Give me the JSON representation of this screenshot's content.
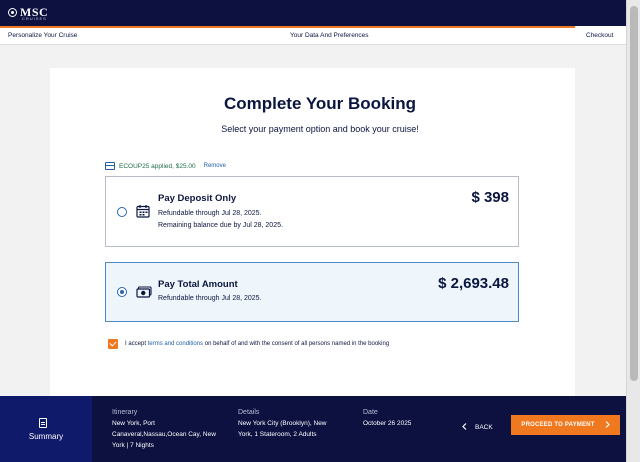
{
  "brand": {
    "name": "MSC",
    "subtitle": "CRUISES"
  },
  "steps": [
    "Personalize Your Cruise",
    "Your Data And Preferences",
    "Checkout"
  ],
  "page": {
    "title": "Complete Your Booking",
    "subtitle": "Select your payment option and book your cruise!"
  },
  "coupon": {
    "text": "ECOUP25 applied, $25.00",
    "remove_label": "Remove"
  },
  "options": [
    {
      "title": "Pay Deposit Only",
      "line1": "Refundable through Jul 28, 2025.",
      "line2": "Remaining balance due by Jul 28, 2025.",
      "price": "$ 398",
      "selected": false,
      "icon": "calendar-icon"
    },
    {
      "title": "Pay Total Amount",
      "line1": "Refundable through Jul 28, 2025.",
      "price": "$ 2,693.48",
      "selected": true,
      "icon": "cash-icon"
    }
  ],
  "terms": {
    "prefix": "I accept",
    "link": "terms and conditions",
    "suffix": "on behalf of and with the consent of all persons named in the booking"
  },
  "footer": {
    "summary_label": "Summary",
    "itinerary_label": "Itinerary",
    "itinerary_line1": "New York, Port",
    "itinerary_line2": "Canaveral,Nassau,Ocean Cay, New",
    "itinerary_line3": "York | 7 Nights",
    "details_label": "Details",
    "details_line1": "New York City (Brooklyn), New",
    "details_line2": "York, 1 Stateroom, 2 Adults",
    "date_label": "Date",
    "date_value": "October 26 2025",
    "back_label": "BACK",
    "proceed_label": "PROCEED TO PAYMENT"
  },
  "colors": {
    "navy": "#0c1140",
    "orange": "#f0781e",
    "link": "#1f5fa8"
  }
}
